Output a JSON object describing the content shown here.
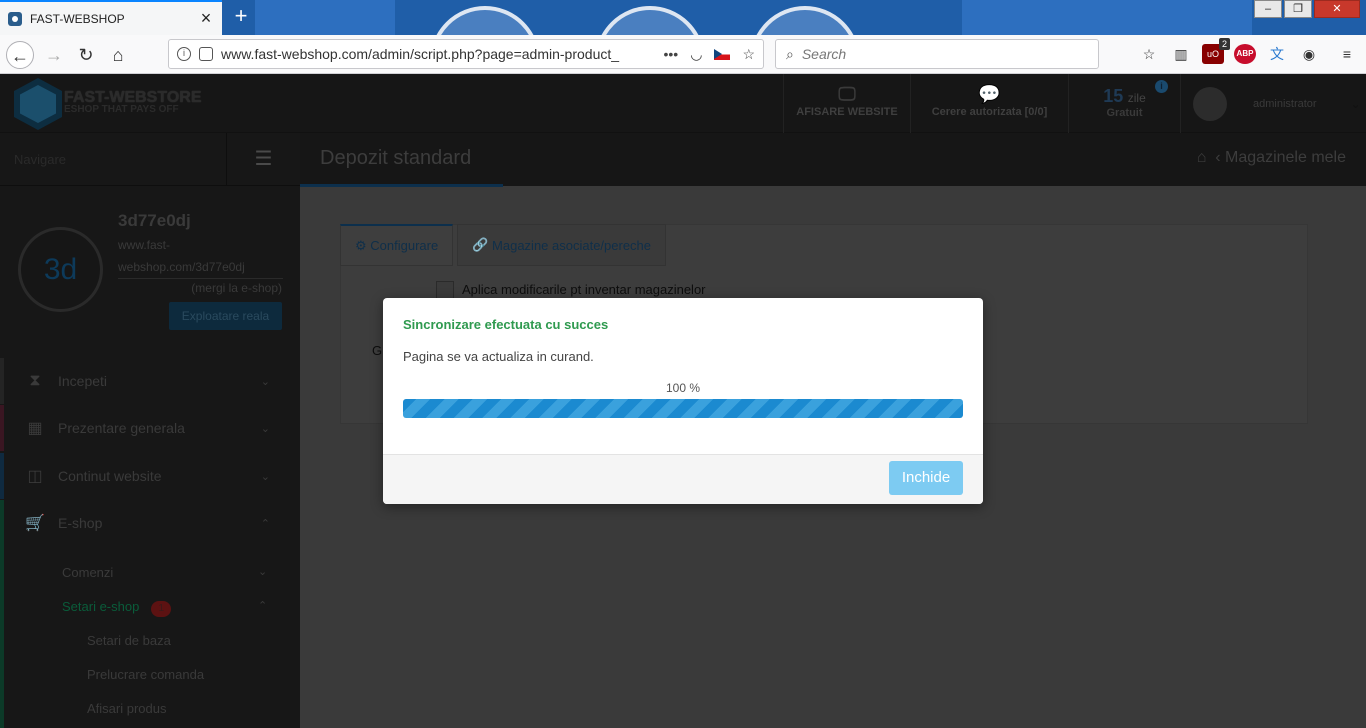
{
  "browser": {
    "tab_title": "FAST-WEBSHOP",
    "url": "www.fast-webshop.com/admin/script.php?page=admin-product_",
    "search_placeholder": "Search",
    "ublock_count": "2",
    "abp_label": "ABP"
  },
  "topbar": {
    "logo_line1": "FAST-WEBSTORE",
    "logo_line2": "ESHOP THAT PAYS OFF",
    "view_website": "AFISARE WEBSITE",
    "auth_request": "Cerere autorizata [0/0]",
    "days_number": "15",
    "days_unit": "zile",
    "plan": "Gratuit",
    "user_name": "administrator"
  },
  "sidebar": {
    "nav_label": "Navigare",
    "profile_name": "3d77e0dj",
    "profile_site_line1": "www.fast-",
    "profile_site_line2": "webshop.com/3d77e0dj",
    "go_shop": "(mergi la e-shop)",
    "exploit_button": "Exploatare reala",
    "avatar_initials": "3d",
    "menu": [
      {
        "label": "Incepeti"
      },
      {
        "label": "Prezentare generala"
      },
      {
        "label": "Continut website"
      },
      {
        "label": "E-shop"
      }
    ],
    "sub": {
      "orders": "Comenzi",
      "settings": "Setari e-shop",
      "settings_badge": "1",
      "basic": "Setari de baza",
      "processing": "Prelucrare comanda",
      "display": "Afisari produs"
    }
  },
  "content": {
    "title": "Depozit standard",
    "breadcrumb": "Magazinele mele",
    "tabs": [
      "Configurare",
      "Magazine asociate/pereche"
    ],
    "checkbox_label": "Aplica modificarile pt inventar magazinelor",
    "g_fragment": "G"
  },
  "modal": {
    "title": "Sincronizare efectuata cu succes",
    "message": "Pagina se va actualiza in curand.",
    "progress_text": "100 %",
    "progress_value": 100,
    "close_label": "Inchide"
  },
  "colors": {
    "success": "#2f9a4f",
    "progress": "#1b8ad0",
    "close_button": "#7dcbf2"
  }
}
